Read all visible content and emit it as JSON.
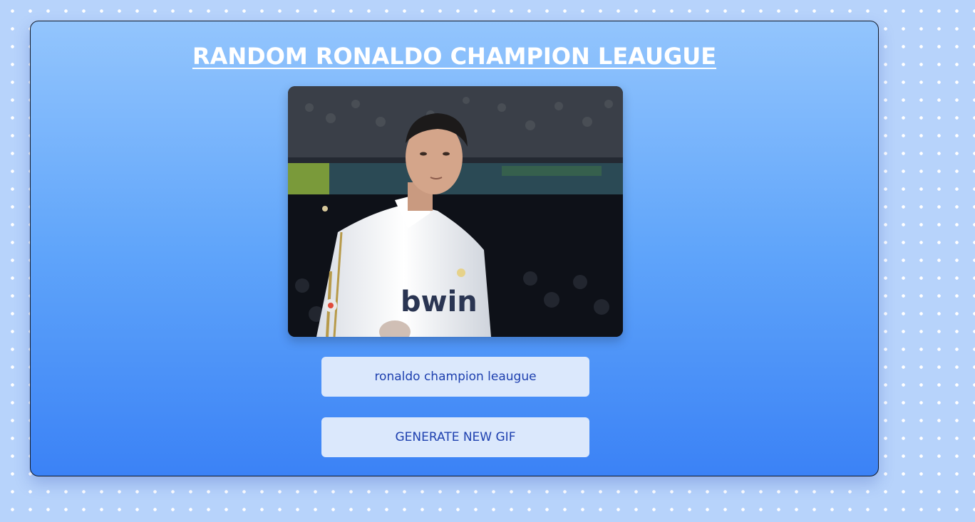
{
  "title": "RANDOM RONALDO CHAMPION LEAUGUE",
  "gif": {
    "sponsor_text": "bwin"
  },
  "search": {
    "value": "ronaldo champion leaugue"
  },
  "generate_button": {
    "label": "GENERATE NEW GIF"
  },
  "colors": {
    "card_top": "#93c5fd",
    "card_bottom": "#3b82f6",
    "button_bg": "#dbe8fc",
    "button_text": "#1e40af",
    "page_bg": "#b7d3fb"
  }
}
